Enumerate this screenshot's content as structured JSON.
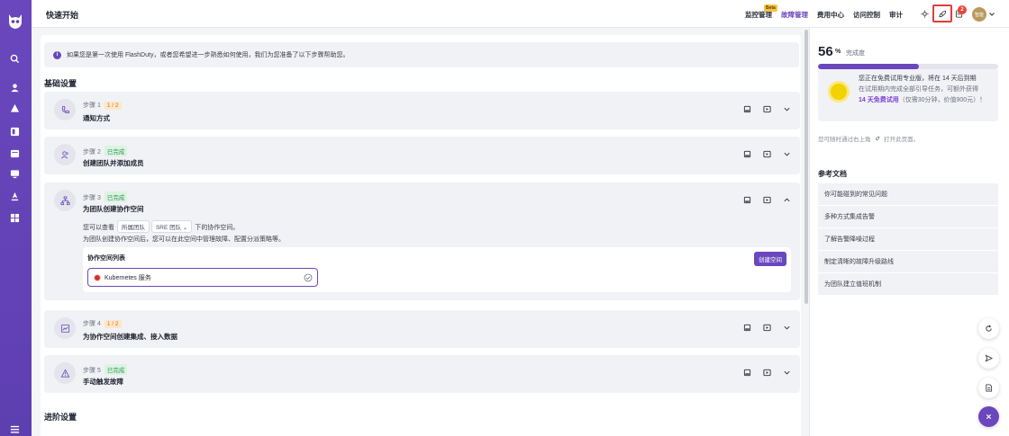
{
  "header": {
    "title": "快速开始",
    "nav": [
      {
        "label": "监控管理",
        "badge": "Beta"
      },
      {
        "label": "故障管理",
        "active": true
      },
      {
        "label": "费用中心"
      },
      {
        "label": "访问控制"
      },
      {
        "label": "审计"
      }
    ],
    "notification_count": "2",
    "avatar_text": "智能"
  },
  "info": {
    "text": "如果您是第一次使用 FlashDuty，或者您希望进一步熟悉如何使用，我们为您准备了以下步骤帮助您。"
  },
  "sections": {
    "basic": "基础设置",
    "advanced": "进阶设置"
  },
  "steps": [
    {
      "label": "步骤 1",
      "tag": "1 / 2",
      "tag_type": "progress",
      "title": "通知方式",
      "icon": "phone-icon"
    },
    {
      "label": "步骤 2",
      "tag": "已完成",
      "tag_type": "done",
      "title": "创建团队并添加成员",
      "icon": "users-icon"
    },
    {
      "label": "步骤 3",
      "tag": "已完成",
      "tag_type": "done",
      "title": "为团队创建协作空间",
      "icon": "org-icon",
      "expanded": true,
      "detail_prefix": "您可以查看",
      "pill1": "所属团队",
      "pill2": "SRE 团队",
      "detail_suffix": "下的协作空间。",
      "detail_line2": "为团队创建协作空间后，您可以在此空间中管理故障、配置分派策略等。",
      "workspace_list_title": "协作空间列表",
      "create_button": "创建空间",
      "workspace_name": "Kubernetes 服务"
    },
    {
      "label": "步骤 4",
      "tag": "1 / 2",
      "tag_type": "progress",
      "title": "为协作空间创建集成、接入数据",
      "icon": "chart-icon"
    },
    {
      "label": "步骤 5",
      "tag": "已完成",
      "tag_type": "done",
      "title": "手动触发故障",
      "icon": "alert-icon"
    }
  ],
  "progress": {
    "percent": "56",
    "percent_sign": "%",
    "label": "完成度",
    "fraction": 0.56
  },
  "trial": {
    "line1": "您正在免费试用专业版，将在 14 天后到期",
    "line2": "在试用期内完成全部引导任务，可额外获得",
    "highlight": "14 天免费试用",
    "muted": "（仅需30分钟，价值900元）！"
  },
  "hint": {
    "prefix": "您可随时通过右上角",
    "suffix": "打开此页面。"
  },
  "references": {
    "title": "参考文档",
    "items": [
      "你可能碰到的常见问题",
      "多种方式集成告警",
      "了解告警降噪过程",
      "制定清晰的故障升级路线",
      "为团队建立值班机制"
    ]
  },
  "colors": {
    "brand": "#6a47bd",
    "highlight_box": "#e23d3d",
    "done": "#2f9a52",
    "in_progress": "#c77a12"
  }
}
